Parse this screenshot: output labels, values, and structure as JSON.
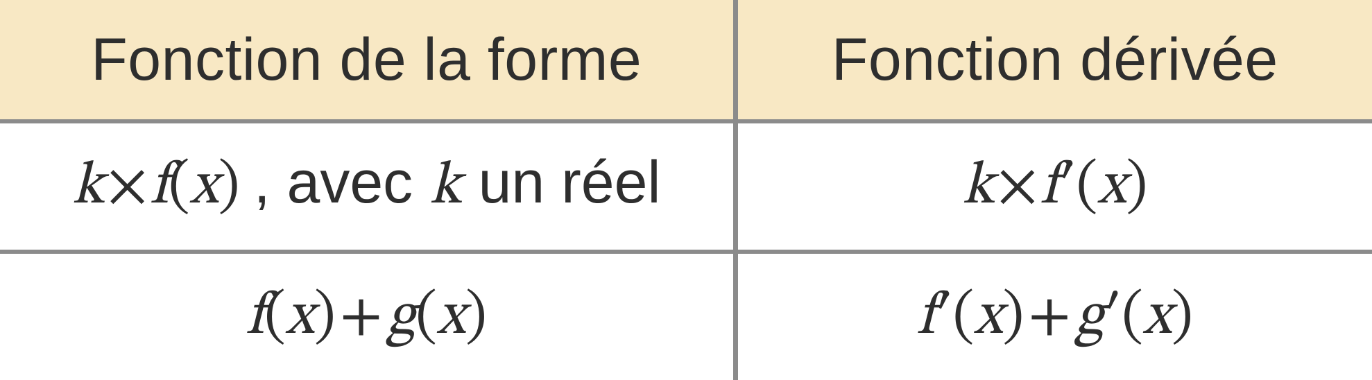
{
  "table": {
    "headers": {
      "left": "Fonction de la forme",
      "right": "Fonction dérivée"
    },
    "rows": [
      {
        "left": {
          "k1": "k",
          "times1": "×",
          "f1": "f",
          "lp1": "(",
          "x1": "x",
          "rp1": ")",
          "comma_text": ", avec ",
          "k2": "k",
          "tail_text": " un réel"
        },
        "right": {
          "k": "k",
          "times": "×",
          "f": "f",
          "prime": "′",
          "lp": "(",
          "x": "x",
          "rp": ")"
        }
      },
      {
        "left": {
          "f": "f",
          "lp1": "(",
          "x1": "x",
          "rp1": ")",
          "plus": "+",
          "g": "g",
          "lp2": "(",
          "x2": "x",
          "rp2": ")"
        },
        "right": {
          "f": "f",
          "fprime": "′",
          "lp1": "(",
          "x1": "x",
          "rp1": ")",
          "plus": "+",
          "g": "g",
          "gprime": "′",
          "lp2": "(",
          "x2": "x",
          "rp2": ")"
        }
      }
    ]
  }
}
